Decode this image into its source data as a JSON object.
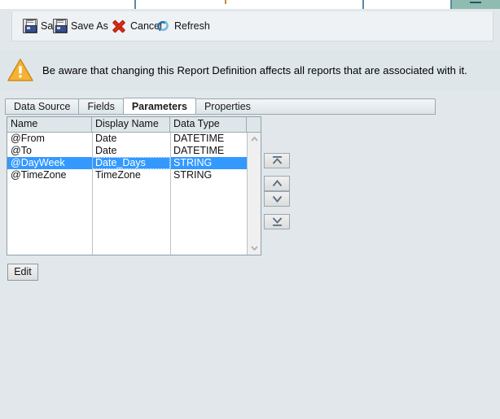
{
  "window_tabs": {
    "active_marker": "minimize-dash"
  },
  "toolbar": {
    "save_label": "Save",
    "save_as_label": "Save As",
    "cancel_label": "Cancel",
    "refresh_label": "Refresh",
    "icons": {
      "save": "floppy-disk-icon",
      "save_as": "floppy-disk-icon",
      "cancel": "red-x-icon",
      "refresh": "circular-arrows-icon"
    }
  },
  "warning": {
    "icon": "warning-triangle-icon",
    "text": "Be aware that changing this Report Definition affects all reports that are associated with it.",
    "accent_color": "#f0a830"
  },
  "tabs": [
    {
      "label": "Data Source",
      "active": false
    },
    {
      "label": "Fields",
      "active": false
    },
    {
      "label": "Parameters",
      "active": true
    },
    {
      "label": "Properties",
      "active": false
    }
  ],
  "grid": {
    "columns": [
      "Name",
      "Display Name",
      "Data Type"
    ],
    "rows": [
      {
        "name": "@From",
        "display_name": "Date",
        "data_type": "DATETIME",
        "selected": false
      },
      {
        "name": "@To",
        "display_name": "Date",
        "data_type": "DATETIME",
        "selected": false
      },
      {
        "name": "@DayWeek",
        "display_name": "Date_Days",
        "data_type": "STRING",
        "selected": true
      },
      {
        "name": "@TimeZone",
        "display_name": "TimeZone",
        "data_type": "STRING",
        "selected": false
      }
    ],
    "selection_color": "#3399ff",
    "scrollbar": {
      "up_arrow": "chevron-up-icon",
      "down_arrow": "chevron-down-icon"
    }
  },
  "move_buttons": [
    {
      "name": "move-to-top",
      "glyph": "bar-up-arrow-icon"
    },
    {
      "name": "move-up",
      "glyph": "chevron-up-icon"
    },
    {
      "name": "move-down",
      "glyph": "chevron-down-icon"
    },
    {
      "name": "move-to-bottom",
      "glyph": "bar-down-arrow-icon"
    }
  ],
  "buttons": {
    "edit_label": "Edit"
  }
}
